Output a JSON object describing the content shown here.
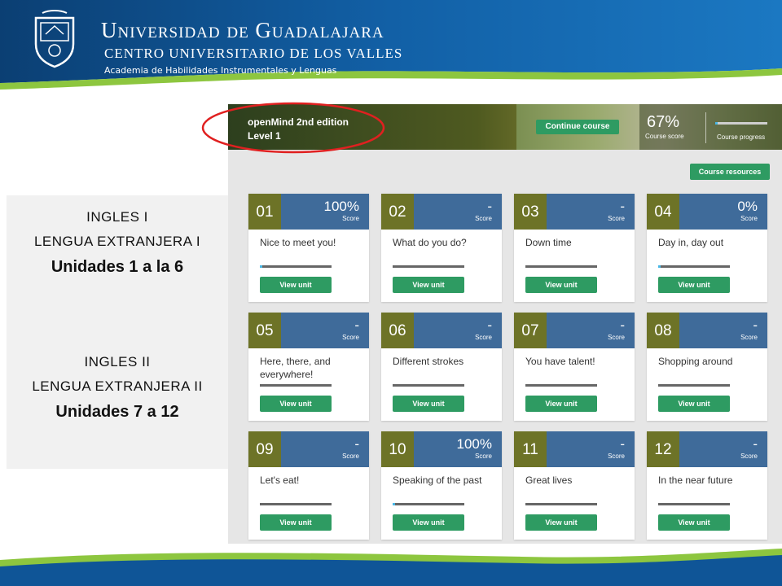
{
  "header": {
    "university": "Universidad de Guadalajara",
    "center": "CENTRO UNIVERSITARIO DE LOS VALLES",
    "academy": "Academia de Habilidades Instrumentales y Lenguas",
    "colors": {
      "blue": "#0e4f8a",
      "green": "#8dc63f"
    }
  },
  "left_panel": {
    "block1": {
      "line1": "INGLES I",
      "line2": "LENGUA EXTRANJERA I",
      "units": "Unidades 1 a la 6"
    },
    "block2": {
      "line1": "INGLES II",
      "line2": "LENGUA EXTRANJERA II",
      "units": "Unidades 7 a 12"
    }
  },
  "course": {
    "title_line1": "openMind 2nd edition",
    "title_line2": "Level 1",
    "continue_label": "Continue course",
    "score": "67%",
    "score_label": "Course score",
    "progress_label": "Course progress",
    "progress": 0.05,
    "resources_label": "Course resources",
    "score_unknown": "-",
    "score_caption": "Score",
    "view_unit_label": "View unit",
    "colors": {
      "button": "#2e9b62",
      "card_head": "#3f6b9a",
      "card_number": "#6d7327",
      "progress": "#49b7e5",
      "highlight": "#e02020"
    }
  },
  "units": [
    {
      "num": "01",
      "score": "100%",
      "title": "Nice to meet you!",
      "progress": 0.03
    },
    {
      "num": "02",
      "score": "-",
      "title": "What do you do?",
      "progress": 0
    },
    {
      "num": "03",
      "score": "-",
      "title": "Down time",
      "progress": 0
    },
    {
      "num": "04",
      "score": "0%",
      "title": "Day in, day out",
      "progress": 0.03
    },
    {
      "num": "05",
      "score": "-",
      "title": "Here, there, and everywhere!",
      "progress": 0
    },
    {
      "num": "06",
      "score": "-",
      "title": "Different strokes",
      "progress": 0
    },
    {
      "num": "07",
      "score": "-",
      "title": "You have talent!",
      "progress": 0
    },
    {
      "num": "08",
      "score": "-",
      "title": "Shopping around",
      "progress": 0
    },
    {
      "num": "09",
      "score": "-",
      "title": "Let's eat!",
      "progress": 0
    },
    {
      "num": "10",
      "score": "100%",
      "title": "Speaking of the past",
      "progress": 0.03
    },
    {
      "num": "11",
      "score": "-",
      "title": "Great lives",
      "progress": 0
    },
    {
      "num": "12",
      "score": "-",
      "title": "In the near future",
      "progress": 0
    }
  ]
}
